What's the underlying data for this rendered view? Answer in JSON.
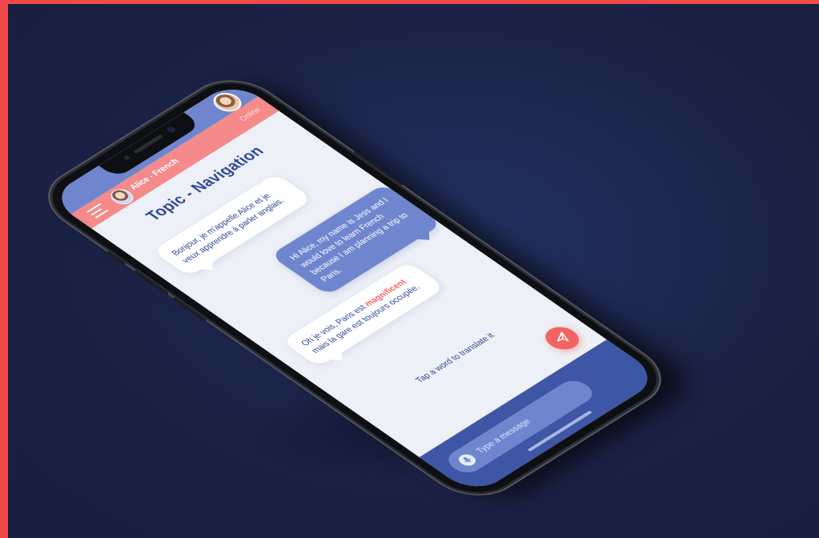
{
  "header": {
    "contact_name": "Alice - French",
    "status": "Online"
  },
  "chat": {
    "topic_title": "Topic - Navigation",
    "messages": [
      {
        "from": "bot",
        "text": "Bonjour, je m'appelle Alice et je veux apprendre à parler anglais."
      },
      {
        "from": "user",
        "text": "Hi Alice, my name is Jess and I would love to learn French because I am planning a trip to Paris."
      },
      {
        "from": "bot",
        "text_before": "Oh je vois, Paris est ",
        "highlight": "magnificent",
        "text_after": " mais la gare est toujours occupée."
      }
    ],
    "hint": "Tap a word to translate it"
  },
  "composer": {
    "placeholder": "Type a message"
  },
  "icons": {
    "menu": "hamburger-menu-icon",
    "send": "paper-plane-icon",
    "mic": "microphone-icon"
  },
  "colors": {
    "page_border": "#f04949",
    "background": "#1b2245",
    "primary": "#6f86cf",
    "accent": "#f48a8a",
    "send": "#f26464",
    "footer": "#3d56a5",
    "title": "#2f4796"
  }
}
